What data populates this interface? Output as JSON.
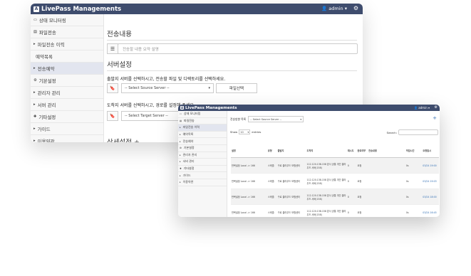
{
  "app": {
    "title": "LivePass Managements",
    "user": "admin ▾",
    "logo_letter": "A"
  },
  "sidebar": {
    "items": [
      {
        "label": "상태 모니터링",
        "icon": "monitor-icon"
      },
      {
        "label": "파일전송",
        "icon": "file-icon"
      },
      {
        "label": "파일전송 이력",
        "icon": "chevron-right-icon"
      },
      {
        "label": "예약목록",
        "icon": "none"
      },
      {
        "label": "전송예약",
        "icon": "chevron-right-icon",
        "active": true
      },
      {
        "label": "기본설정",
        "icon": "gear-icon"
      },
      {
        "label": "관리자 관리",
        "icon": "chevron-right-icon"
      },
      {
        "label": "서버 관리",
        "icon": "chevron-right-icon"
      },
      {
        "label": "기타설정",
        "icon": "plus-icon"
      },
      {
        "label": "가이드",
        "icon": "chevron-right-icon"
      },
      {
        "label": "이용약관",
        "icon": "chevron-right-icon"
      }
    ]
  },
  "back_main": {
    "section1_title": "전송내용",
    "memo_placeholder": "전송할 내용 요약 설명",
    "section2_title": "서버설정",
    "source_desc": "출발지 서버를 선택하시고, 전송할 파일 및 디렉토리를 선택하세요.",
    "source_select": "-- Select Source Server --",
    "file_select_btn": "파일선택",
    "target_desc": "도착지 서버를 선택하시고, 경로를 설정해 주세요.",
    "target_select": "-- Select Target Server --",
    "section3_title": "상세설정 +"
  },
  "front": {
    "sidebar": [
      {
        "label": "상태 모니터링",
        "icon": "monitor-icon"
      },
      {
        "label": "파일전송",
        "icon": "file-icon"
      },
      {
        "label": "파일전송 이력",
        "icon": "chevron-right-icon",
        "active": true
      },
      {
        "label": "예약목록",
        "icon": "chevron-right-icon"
      },
      {
        "label": "전송예약",
        "icon": "chevron-right-icon"
      },
      {
        "label": "기본설정",
        "icon": "gear-icon"
      },
      {
        "label": "관리자 관리",
        "icon": "chevron-right-icon"
      },
      {
        "label": "서버 관리",
        "icon": "chevron-right-icon"
      },
      {
        "label": "기타설정",
        "icon": "plus-icon"
      },
      {
        "label": "가이드",
        "icon": "chevron-right-icon"
      },
      {
        "label": "이용약관",
        "icon": "chevron-right-icon"
      }
    ],
    "filter_label": "전송방향 목록",
    "filter_select": "-- Select Source Server --",
    "show_label": "Show",
    "show_value": "10",
    "entries_label": "entries",
    "search_label": "Search:",
    "columns": [
      "설명",
      "유형",
      "출발지",
      "도착지",
      "재시도",
      "완료여부",
      "전송내용",
      "작업시간",
      "요청일시"
    ],
    "rows": [
      {
        "desc": "반복설정 Local -> 166",
        "type": "스케줄",
        "src": "구로 클라우드 보험센터",
        "dst": "112.120.138.158 본사 공통 개인 클라우드 서버(158)",
        "retry": "0",
        "done": "요청",
        "content": "",
        "time": "0s",
        "date": "03/24 19:00"
      },
      {
        "desc": "반복설정 Local -> 166",
        "type": "스케줄",
        "src": "구로 클라우드 보험센터",
        "dst": "112.120.138.158 본사 공통 개인 클라우드 서버(158)",
        "retry": "0",
        "done": "요청",
        "content": "",
        "time": "0s",
        "date": "03/24 19:03"
      },
      {
        "desc": "반복설정 Local -> 166",
        "type": "스케줄",
        "src": "구로 클라우드 보험센터",
        "dst": "112.120.138.158 본사 공통 개인 클라우드 서버(158)",
        "retry": "0",
        "done": "요청",
        "content": "",
        "time": "0s",
        "date": "03/24 18:00"
      },
      {
        "desc": "반복설정 Local -> 166",
        "type": "스케줄",
        "src": "구로 클라우드 보험센터",
        "dst": "112.120.138.158 본사 공통 개인 클라우드 서버(158)",
        "retry": "0",
        "done": "요청",
        "content": "",
        "time": "0s",
        "date": "03/24 16:45"
      }
    ]
  }
}
